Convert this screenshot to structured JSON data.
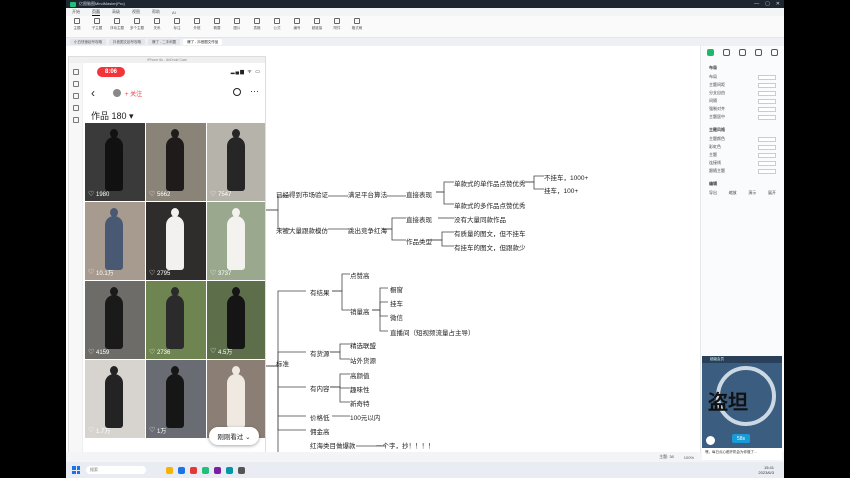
{
  "app": {
    "title": "亿图脑图MindMaster(Pro)",
    "menu": [
      "开始",
      "页面",
      "高级",
      "视图",
      "帮助",
      "AI"
    ],
    "active_menu": "页面",
    "tools": [
      "主题",
      "子主题",
      "浮动主题",
      "多个主题",
      "关系",
      "标注",
      "外框",
      "概要",
      "图片",
      "表格",
      "公式",
      "编号",
      "超链接",
      "附件",
      "格式刷"
    ],
    "doc_tabs": [
      "小白快速起号攻略",
      "抖音图文起号攻略",
      "爆了 - 二手闲置",
      "爆了 - 抖音图文作品"
    ],
    "status": [
      "主题: 38",
      "100%"
    ]
  },
  "phone": {
    "window_title": "iPhone 6s - AirDroid Cast",
    "time": "8:06",
    "status_icons": "▂▄▆ ᯤ ▭",
    "back": "‹",
    "follow": "+ 关注",
    "more": "···",
    "works_label": "作品 180 ▾",
    "seen_button": "刚刚看过 ⌄",
    "posts": [
      {
        "likes": "1980",
        "bg": "#3b3a3a",
        "fig": "#111"
      },
      {
        "likes": "5662",
        "bg": "#8a8378",
        "fig": "#1e1b1a"
      },
      {
        "likes": "7547",
        "bg": "#b6b3aa",
        "fig": "#262626"
      },
      {
        "likes": "10.1万",
        "bg": "#a79a8e",
        "fig": "#4a5973"
      },
      {
        "likes": "2795",
        "bg": "#2f2d2b",
        "fig": "#f3f1ef"
      },
      {
        "likes": "3737",
        "bg": "#9aa98d",
        "fig": "#f3f2ee"
      },
      {
        "likes": "4159",
        "bg": "#6e6c69",
        "fig": "#1a1a1a"
      },
      {
        "likes": "2736",
        "bg": "#6f8551",
        "fig": "#2b2b2b"
      },
      {
        "likes": "4.5万",
        "bg": "#5c6f4a",
        "fig": "#151515"
      },
      {
        "likes": "1.7万",
        "bg": "#d7d4cf",
        "fig": "#232323"
      },
      {
        "likes": "1万",
        "bg": "#696d73",
        "fig": "#161616"
      },
      {
        "likes": "",
        "bg": "#8b7f75",
        "fig": "#efe9e2"
      }
    ]
  },
  "mindmap": {
    "n_verified": "已经得到市场验证",
    "n_platform": "满足平台算法",
    "n_direct1": "直接表现",
    "n_single": "单款式的单作品点赞优秀",
    "n_multi": "单款式的多作品点赞优秀",
    "n_nocar": "不挂车，1000+",
    "n_car": "挂车，100+",
    "n_notcopied": "未被大量跟款模仿",
    "n_redocean": "跳出竞争红海",
    "n_direct2": "直接表现",
    "n_nosame": "没有大量同款作品",
    "n_type": "作品类型",
    "n_qualitynocar": "有质量的图文，但不挂车",
    "n_carless": "有挂车的图文，但跟款少",
    "n_standard": "标准",
    "n_effect": "有结果",
    "n_likes": "点赞高",
    "n_sales": "销量高",
    "n_window": "橱窗",
    "n_carb": "挂车",
    "n_wechat": "微信",
    "n_live": "直播间（短视频流量占主导）",
    "n_supply": "有货源",
    "n_selected": "精选联盟",
    "n_offsite": "站外货源",
    "n_content": "有内容",
    "n_looks": "高颜值",
    "n_fun": "趣味性",
    "n_novel": "新奇特",
    "n_lowprice": "价格低",
    "n_under100": "100元以内",
    "n_commission": "佣金高",
    "n_redocean2": "红海类目做爆款",
    "n_copy": "一个字，抄！！！！"
  },
  "right_panel": {
    "section1": "布局",
    "rows1": [
      "布局",
      "主题间距",
      "分支自由",
      "间隔",
      "强制对齐",
      "主题居中"
    ],
    "section2": "主题风格",
    "rows2": [
      "主题颜色",
      "彩虹色",
      "主题",
      "连接线",
      "跟随主题"
    ],
    "section3": "编辑",
    "tools3": [
      "导出",
      "缩放",
      "演示",
      "展开"
    ]
  },
  "video": {
    "title": "超级会员",
    "big_text": "盗坦",
    "badge": "58s",
    "caption": "嘿，每日点心都开机会为你做了..."
  },
  "taskbar": {
    "search": "搜索",
    "clock_time": "15:41",
    "clock_date": "2023/6/3"
  }
}
